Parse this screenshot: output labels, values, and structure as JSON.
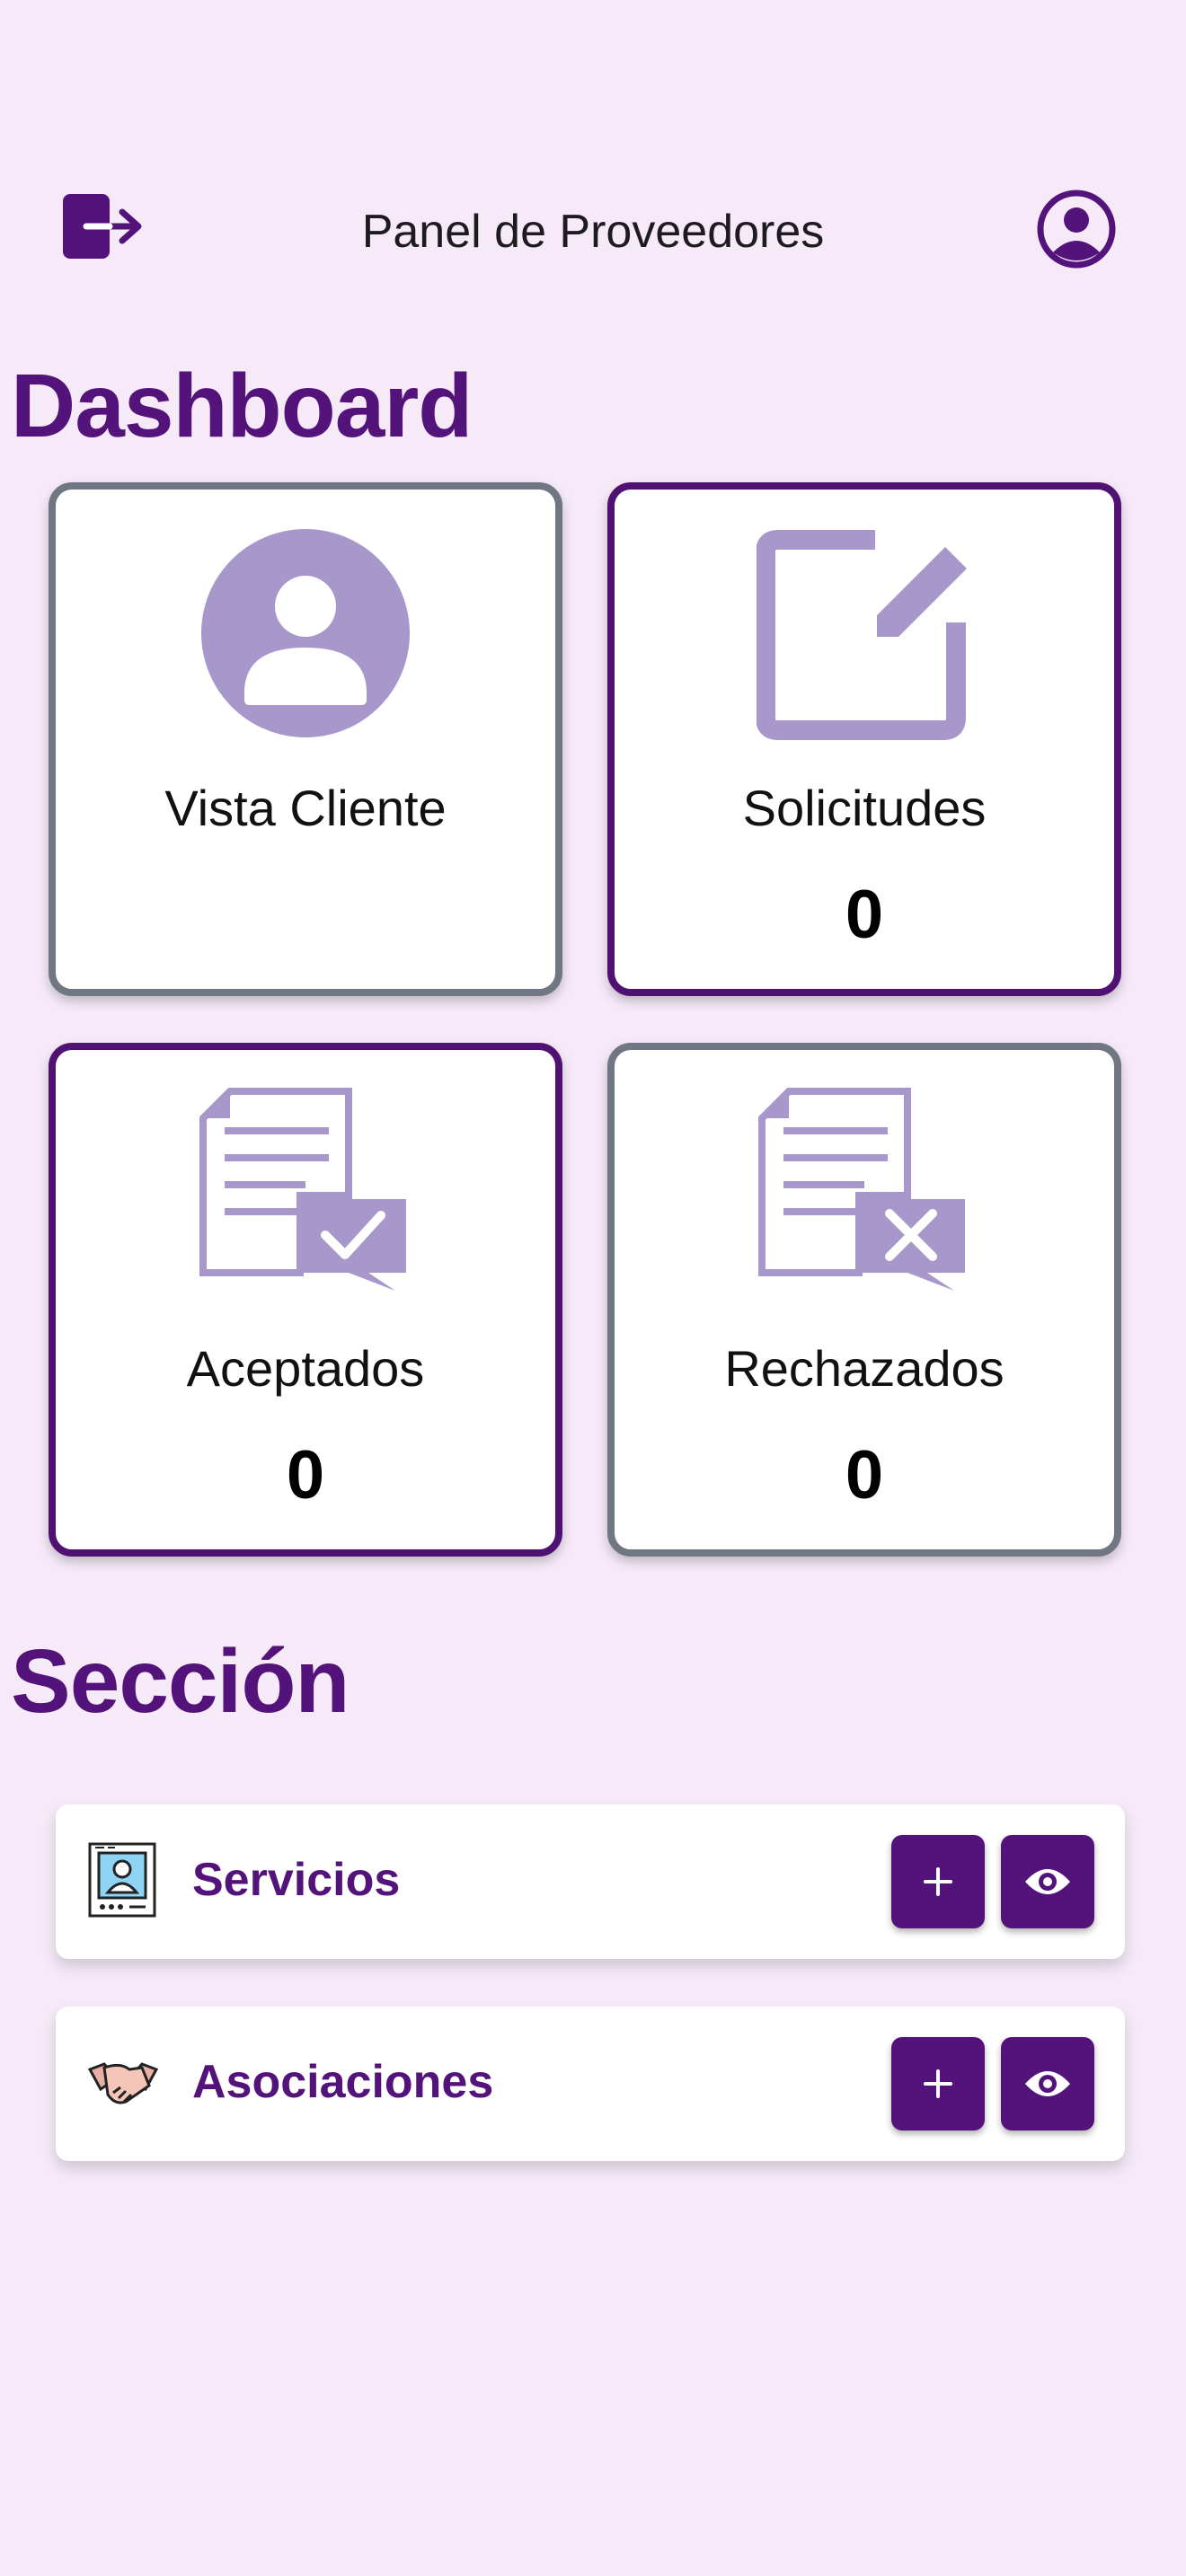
{
  "header": {
    "title": "Panel de Proveedores",
    "logout_icon": "logout-icon",
    "profile_icon": "account-circle-icon"
  },
  "dashboard": {
    "heading": "Dashboard",
    "cards": [
      {
        "label": "Vista Cliente",
        "icon": "person-avatar-icon"
      },
      {
        "label": "Solicitudes",
        "count": "0",
        "icon": "edit-note-icon"
      },
      {
        "label": "Aceptados",
        "count": "0",
        "icon": "document-check-icon"
      },
      {
        "label": "Rechazados",
        "count": "0",
        "icon": "document-x-icon"
      }
    ]
  },
  "section": {
    "heading": "Sección",
    "rows": [
      {
        "label": "Servicios",
        "icon": "id-card-icon",
        "add_symbol": "+"
      },
      {
        "label": "Asociaciones",
        "icon": "handshake-icon",
        "add_symbol": "+"
      }
    ]
  },
  "colors": {
    "primary": "#53137a",
    "background": "#f6eaf8",
    "icon_tint": "#a897ca",
    "card_border_neutral": "#707782"
  }
}
